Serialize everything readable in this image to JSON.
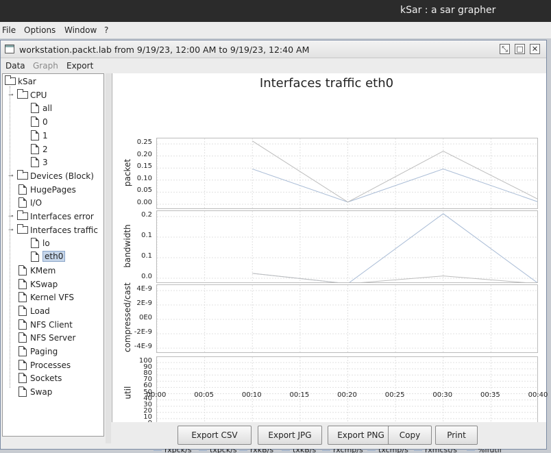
{
  "window": {
    "title": "kSar : a sar grapher"
  },
  "main_menu": [
    "File",
    "Options",
    "Window",
    "?"
  ],
  "internal_frame": {
    "title": "workstation.packt.lab from 9/19/23, 12:00 AM to 9/19/23, 12:40 AM",
    "menu": [
      {
        "label": "Data",
        "enabled": true
      },
      {
        "label": "Graph",
        "enabled": false
      },
      {
        "label": "Export",
        "enabled": true
      }
    ]
  },
  "tree": {
    "root": "kSar",
    "items": [
      {
        "label": "CPU",
        "type": "folder",
        "level": 1,
        "expanded": true
      },
      {
        "label": "all",
        "type": "leaf",
        "level": 2
      },
      {
        "label": "0",
        "type": "leaf",
        "level": 2
      },
      {
        "label": "1",
        "type": "leaf",
        "level": 2
      },
      {
        "label": "2",
        "type": "leaf",
        "level": 2
      },
      {
        "label": "3",
        "type": "leaf",
        "level": 2
      },
      {
        "label": "Devices (Block)",
        "type": "folder",
        "level": 1,
        "expanded": false
      },
      {
        "label": "HugePages",
        "type": "leaf",
        "level": 1
      },
      {
        "label": "I/O",
        "type": "leaf",
        "level": 1
      },
      {
        "label": "Interfaces error",
        "type": "folder",
        "level": 1,
        "expanded": false
      },
      {
        "label": "Interfaces traffic",
        "type": "folder",
        "level": 1,
        "expanded": true
      },
      {
        "label": "lo",
        "type": "leaf",
        "level": 2
      },
      {
        "label": "eth0",
        "type": "leaf",
        "level": 2,
        "selected": true
      },
      {
        "label": "KMem",
        "type": "leaf",
        "level": 1
      },
      {
        "label": "KSwap",
        "type": "leaf",
        "level": 1
      },
      {
        "label": "Kernel VFS",
        "type": "leaf",
        "level": 1
      },
      {
        "label": "Load",
        "type": "leaf",
        "level": 1
      },
      {
        "label": "NFS Client",
        "type": "leaf",
        "level": 1
      },
      {
        "label": "NFS Server",
        "type": "leaf",
        "level": 1
      },
      {
        "label": "Paging",
        "type": "leaf",
        "level": 1
      },
      {
        "label": "Processes",
        "type": "leaf",
        "level": 1
      },
      {
        "label": "Sockets",
        "type": "leaf",
        "level": 1
      },
      {
        "label": "Swap",
        "type": "leaf",
        "level": 1
      }
    ]
  },
  "chart_data": {
    "type": "line",
    "title": "Interfaces traffic eth0",
    "x": [
      "00:00",
      "00:05",
      "00:10",
      "00:15",
      "00:20",
      "00:25",
      "00:30",
      "00:35",
      "00:40"
    ],
    "x_ticks": [
      "00:00",
      "00:05",
      "00:10",
      "00:15",
      "00:20",
      "00:25",
      "00:30",
      "00:35",
      "00:40"
    ],
    "grid": true,
    "legend_position": "bottom",
    "colors": {
      "line_primary": "#a9bcd6",
      "line_secondary": "#bdbdbd",
      "grid": "#e0e0e0"
    },
    "subplots": [
      {
        "ylabel": "packet",
        "ylim": [
          0,
          0.28
        ],
        "y_ticks": [
          "0.25",
          "0.20",
          "0.15",
          "0.10",
          "0.05",
          "0.00"
        ],
        "series": [
          {
            "name": "rxpck/s",
            "x": [
              "00:10",
              "00:20",
              "00:30",
              "00:40"
            ],
            "values": [
              0.16,
              0.03,
              0.16,
              0.03
            ]
          },
          {
            "name": "txpck/s",
            "x": [
              "00:10",
              "00:20",
              "00:30",
              "00:40"
            ],
            "values": [
              0.27,
              0.03,
              0.23,
              0.04
            ]
          }
        ]
      },
      {
        "ylabel": "bandwidth",
        "ylim": [
          0,
          0.28
        ],
        "y_ticks": [
          "0.2",
          "0.1",
          "0.1",
          "0.0"
        ],
        "series": [
          {
            "name": "rxkB/s",
            "x": [
              "00:10",
              "00:20",
              "00:30",
              "00:40"
            ],
            "values": [
              0.04,
              0.0,
              0.27,
              0.0
            ]
          },
          {
            "name": "txkB/s",
            "x": [
              "00:10",
              "00:20",
              "00:30",
              "00:40"
            ],
            "values": [
              0.04,
              0.0,
              0.03,
              0.0
            ]
          }
        ]
      },
      {
        "ylabel": "compressed/cast",
        "ylim": [
          -5e-09,
          5e-09
        ],
        "y_ticks": [
          "4E-9",
          "2E-9",
          "0E0",
          "-2E-9",
          "-4E-9"
        ],
        "series": [
          {
            "name": "rxcmp/s",
            "values": []
          },
          {
            "name": "txcmp/s",
            "values": []
          },
          {
            "name": "rxmcst/s",
            "values": []
          }
        ]
      },
      {
        "ylabel": "util",
        "ylim": [
          0,
          100
        ],
        "y_ticks": [
          "100",
          "90",
          "80",
          "70",
          "60",
          "50",
          "40",
          "30",
          "20",
          "10",
          "0"
        ],
        "series": [
          {
            "name": "%ifutil",
            "values": []
          }
        ]
      }
    ],
    "legend": [
      "rxpck/s",
      "txpck/s",
      "rxkB/s",
      "txkB/s",
      "rxcmp/s",
      "txcmp/s",
      "rxmcst/s",
      "%ifutil"
    ]
  },
  "buttons": [
    "Export CSV",
    "Export JPG",
    "Export PNG",
    "Copy",
    "Print"
  ],
  "icons": {
    "frame_iconify": "iconify-icon",
    "frame_maximize": "maximize-icon",
    "frame_close": "close-icon",
    "frame_doc": "document-icon"
  }
}
